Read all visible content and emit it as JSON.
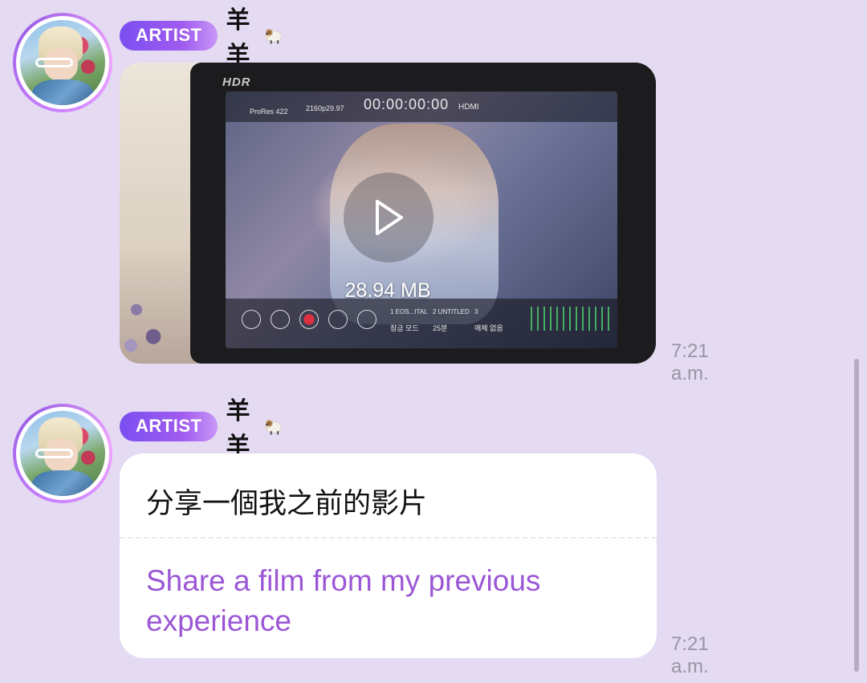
{
  "messages": [
    {
      "badge": "ARTIST",
      "sender": "羊羊",
      "sender_emoji": "ram-emoji",
      "type": "video",
      "file_size": "28.94 MB",
      "timestamp": "7:21 a.m.",
      "video_preview": {
        "hdr_label": "HDR",
        "codec": "ProRes 422",
        "resolution": "2160p29.97",
        "timecode": "00:00:00:00",
        "source": "HDMI",
        "track1": "1  EOS...ITAL",
        "track2": "2  UNTITLED",
        "track3": "3",
        "mode1": "잠금 모드",
        "mode2": "25분",
        "mode3": "매체 없음"
      }
    },
    {
      "badge": "ARTIST",
      "sender": "羊羊",
      "sender_emoji": "ram-emoji",
      "type": "text",
      "original_text": "分享一個我之前的影片",
      "translated_text": "Share a film from my previous experience",
      "timestamp": "7:21 a.m."
    }
  ],
  "colors": {
    "background": "#e4daf2",
    "badge_gradient_start": "#7a4ff0",
    "translation_text": "#9b57d6",
    "timestamp_text": "#9a93a3"
  }
}
